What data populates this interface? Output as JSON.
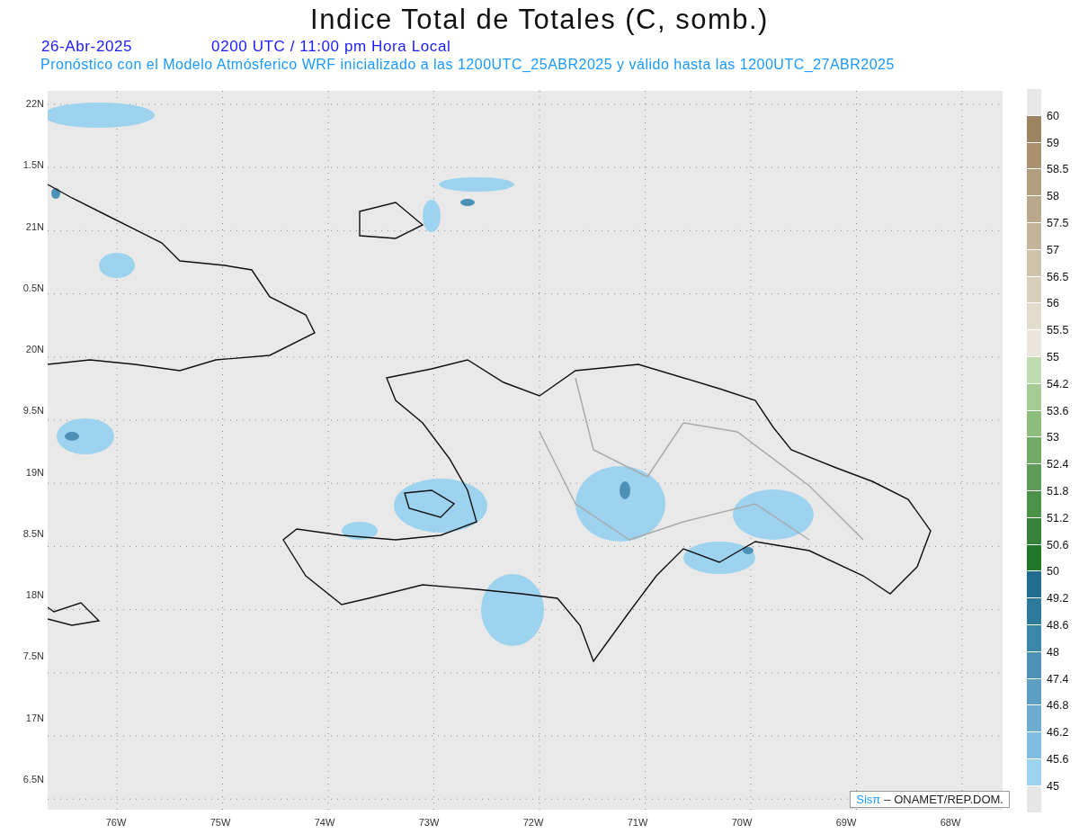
{
  "title": "Indice Total de Totales (C, somb.)",
  "date": "26-Abr-2025",
  "time": "0200 UTC / 11:00 pm Hora Local",
  "forecast_note": "Pronóstico con el Modelo Atmósferico WRF inicializado a las 1200UTC_25ABR2025 y válido hasta las  1200UTC_27ABR2025",
  "map": {
    "y_labels": [
      "22N",
      "1.5N",
      "21N",
      "0.5N",
      "20N",
      "9.5N",
      "19N",
      "8.5N",
      "18N",
      "7.5N",
      "17N",
      "6.5N"
    ],
    "x_labels": [
      "76W",
      "75W",
      "74W",
      "73W",
      "72W",
      "71W",
      "70W",
      "69W",
      "68W"
    ]
  },
  "credit": {
    "brand": "Sisπ",
    "text": "– ONAMET/REP.DOM."
  },
  "colorbar": [
    {
      "color": "#e8e8e8",
      "label": "60"
    },
    {
      "color": "#9c8461",
      "label": "59"
    },
    {
      "color": "#a99170",
      "label": "58.5"
    },
    {
      "color": "#b19e7f",
      "label": "58"
    },
    {
      "color": "#baa88a",
      "label": "57.5"
    },
    {
      "color": "#c4b49a",
      "label": "57"
    },
    {
      "color": "#cfc2aa",
      "label": "56.5"
    },
    {
      "color": "#d9cfbd",
      "label": "56"
    },
    {
      "color": "#e2dccf",
      "label": "55.5"
    },
    {
      "color": "#ebe7de",
      "label": "55"
    },
    {
      "color": "#bfdcb0",
      "label": "54.2"
    },
    {
      "color": "#a6cc96",
      "label": "53.6"
    },
    {
      "color": "#8cbd7c",
      "label": "53"
    },
    {
      "color": "#72aa66",
      "label": "52.4"
    },
    {
      "color": "#5e9d58",
      "label": "51.8"
    },
    {
      "color": "#4b9148",
      "label": "51.2"
    },
    {
      "color": "#37823a",
      "label": "50.6"
    },
    {
      "color": "#217728",
      "label": "50"
    },
    {
      "color": "#226c8e",
      "label": "49.2"
    },
    {
      "color": "#2d7a9c",
      "label": "48.6"
    },
    {
      "color": "#3b87aa",
      "label": "48"
    },
    {
      "color": "#4d92b6",
      "label": "47.4"
    },
    {
      "color": "#5c9fc2",
      "label": "46.8"
    },
    {
      "color": "#6eacd0",
      "label": "46.2"
    },
    {
      "color": "#80bde0",
      "label": "45.6"
    },
    {
      "color": "#9dd3ef",
      "label": "45"
    },
    {
      "color": "#e6e6e6"
    }
  ]
}
